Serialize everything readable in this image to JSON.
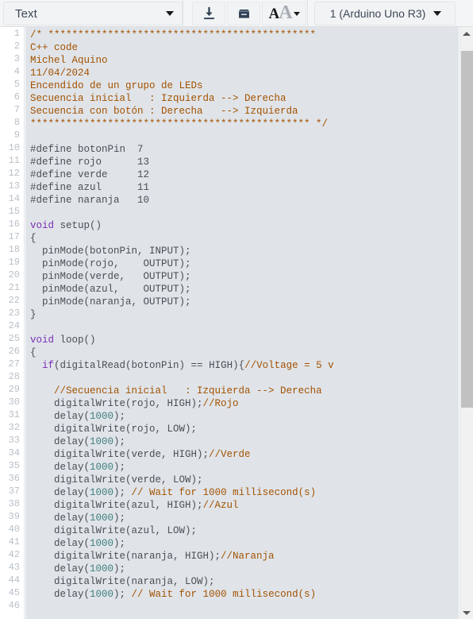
{
  "toolbar": {
    "format_select": {
      "value": "Text",
      "icon": "chevron-down-icon"
    },
    "buttons": [
      {
        "name": "download-button",
        "icon": "download-icon",
        "label": ""
      },
      {
        "name": "archive-button",
        "icon": "archive-box-icon",
        "label": ""
      },
      {
        "name": "font-size-button",
        "icon": "font-size-icon",
        "label_dark": "A",
        "label_light": "A"
      }
    ],
    "board_select": {
      "value": "1 (Arduino Uno R3)",
      "icon": "chevron-down-icon"
    }
  },
  "editor": {
    "language": "cpp",
    "first_line": 1,
    "last_visible_line": 46,
    "line_numbers": [
      "1",
      "2",
      "3",
      "4",
      "5",
      "6",
      "7",
      "8",
      "9",
      "10",
      "11",
      "12",
      "13",
      "14",
      "15",
      "16",
      "17",
      "18",
      "19",
      "20",
      "21",
      "22",
      "23",
      "24",
      "25",
      "26",
      "27",
      "28",
      "29",
      "30",
      "31",
      "32",
      "33",
      "34",
      "35",
      "36",
      "37",
      "38",
      "39",
      "40",
      "41",
      "42",
      "43",
      "44",
      "45",
      "46"
    ],
    "colors": {
      "background": "#e0e4e9",
      "gutter_background": "#ffffff",
      "gutter_text": "#b9c0c8",
      "plain_text": "#4a4f54",
      "comment": "#a35200",
      "keyword": "#7b2fb5",
      "number": "#3f7f7f",
      "scrollbar_thumb": "#c1c1c1"
    },
    "lines": [
      {
        "n": 1,
        "tokens": [
          {
            "t": "cmt",
            "s": "/* *********************************************"
          }
        ]
      },
      {
        "n": 2,
        "tokens": [
          {
            "t": "cmt",
            "s": "C++ code"
          }
        ]
      },
      {
        "n": 3,
        "tokens": [
          {
            "t": "cmt",
            "s": "Michel Aquino"
          }
        ]
      },
      {
        "n": 4,
        "tokens": [
          {
            "t": "cmt",
            "s": "11/04/2024"
          }
        ]
      },
      {
        "n": 5,
        "tokens": [
          {
            "t": "cmt",
            "s": "Encendido de un grupo de LEDs"
          }
        ]
      },
      {
        "n": 6,
        "tokens": [
          {
            "t": "cmt",
            "s": "Secuencia inicial   : Izquierda --> Derecha"
          }
        ]
      },
      {
        "n": 7,
        "tokens": [
          {
            "t": "cmt",
            "s": "Secuencia con botón : Derecha   --> Izquierda"
          }
        ]
      },
      {
        "n": 8,
        "tokens": [
          {
            "t": "cmt",
            "s": "*********************************************** */"
          }
        ]
      },
      {
        "n": 9,
        "tokens": []
      },
      {
        "n": 10,
        "tokens": [
          {
            "t": "pln",
            "s": "#define botonPin  7"
          }
        ]
      },
      {
        "n": 11,
        "tokens": [
          {
            "t": "pln",
            "s": "#define rojo      13"
          }
        ]
      },
      {
        "n": 12,
        "tokens": [
          {
            "t": "pln",
            "s": "#define verde     12"
          }
        ]
      },
      {
        "n": 13,
        "tokens": [
          {
            "t": "pln",
            "s": "#define azul      11"
          }
        ]
      },
      {
        "n": 14,
        "tokens": [
          {
            "t": "pln",
            "s": "#define naranja   10"
          }
        ]
      },
      {
        "n": 15,
        "tokens": []
      },
      {
        "n": 16,
        "tokens": [
          {
            "t": "kw",
            "s": "void"
          },
          {
            "t": "pln",
            "s": " setup()"
          }
        ]
      },
      {
        "n": 17,
        "tokens": [
          {
            "t": "pln",
            "s": "{"
          }
        ]
      },
      {
        "n": 18,
        "tokens": [
          {
            "t": "pln",
            "s": "  pinMode(botonPin, INPUT);"
          }
        ]
      },
      {
        "n": 19,
        "tokens": [
          {
            "t": "pln",
            "s": "  pinMode(rojo,    OUTPUT);"
          }
        ]
      },
      {
        "n": 20,
        "tokens": [
          {
            "t": "pln",
            "s": "  pinMode(verde,   OUTPUT);"
          }
        ]
      },
      {
        "n": 21,
        "tokens": [
          {
            "t": "pln",
            "s": "  pinMode(azul,    OUTPUT);"
          }
        ]
      },
      {
        "n": 22,
        "tokens": [
          {
            "t": "pln",
            "s": "  pinMode(naranja, OUTPUT);"
          }
        ]
      },
      {
        "n": 23,
        "tokens": [
          {
            "t": "pln",
            "s": "}"
          }
        ]
      },
      {
        "n": 24,
        "tokens": []
      },
      {
        "n": 25,
        "tokens": [
          {
            "t": "kw",
            "s": "void"
          },
          {
            "t": "pln",
            "s": " loop()"
          }
        ]
      },
      {
        "n": 26,
        "tokens": [
          {
            "t": "pln",
            "s": "{"
          }
        ]
      },
      {
        "n": 27,
        "tokens": [
          {
            "t": "pln",
            "s": "  "
          },
          {
            "t": "kw",
            "s": "if"
          },
          {
            "t": "pln",
            "s": "(digitalRead(botonPin) == HIGH){"
          },
          {
            "t": "cmt",
            "s": "//Voltage = 5 v"
          }
        ]
      },
      {
        "n": 28,
        "tokens": []
      },
      {
        "n": 29,
        "tokens": [
          {
            "t": "pln",
            "s": "    "
          },
          {
            "t": "cmt",
            "s": "//Secuencia inicial   : Izquierda --> Derecha"
          }
        ]
      },
      {
        "n": 30,
        "tokens": [
          {
            "t": "pln",
            "s": "    digitalWrite(rojo, HIGH);"
          },
          {
            "t": "cmt",
            "s": "//Rojo"
          }
        ]
      },
      {
        "n": 31,
        "tokens": [
          {
            "t": "pln",
            "s": "    delay("
          },
          {
            "t": "num",
            "s": "1000"
          },
          {
            "t": "pln",
            "s": ");"
          }
        ]
      },
      {
        "n": 32,
        "tokens": [
          {
            "t": "pln",
            "s": "    digitalWrite(rojo, LOW);"
          }
        ]
      },
      {
        "n": 33,
        "tokens": [
          {
            "t": "pln",
            "s": "    delay("
          },
          {
            "t": "num",
            "s": "1000"
          },
          {
            "t": "pln",
            "s": ");"
          }
        ]
      },
      {
        "n": 34,
        "tokens": [
          {
            "t": "pln",
            "s": "    digitalWrite(verde, HIGH);"
          },
          {
            "t": "cmt",
            "s": "//Verde"
          }
        ]
      },
      {
        "n": 35,
        "tokens": [
          {
            "t": "pln",
            "s": "    delay("
          },
          {
            "t": "num",
            "s": "1000"
          },
          {
            "t": "pln",
            "s": ");"
          }
        ]
      },
      {
        "n": 36,
        "tokens": [
          {
            "t": "pln",
            "s": "    digitalWrite(verde, LOW);"
          }
        ]
      },
      {
        "n": 37,
        "tokens": [
          {
            "t": "pln",
            "s": "    delay("
          },
          {
            "t": "num",
            "s": "1000"
          },
          {
            "t": "pln",
            "s": "); "
          },
          {
            "t": "cmt",
            "s": "// Wait for 1000 millisecond(s)"
          }
        ]
      },
      {
        "n": 38,
        "tokens": [
          {
            "t": "pln",
            "s": "    digitalWrite(azul, HIGH);"
          },
          {
            "t": "cmt",
            "s": "//Azul"
          }
        ]
      },
      {
        "n": 39,
        "tokens": [
          {
            "t": "pln",
            "s": "    delay("
          },
          {
            "t": "num",
            "s": "1000"
          },
          {
            "t": "pln",
            "s": ");"
          }
        ]
      },
      {
        "n": 40,
        "tokens": [
          {
            "t": "pln",
            "s": "    digitalWrite(azul, LOW);"
          }
        ]
      },
      {
        "n": 41,
        "tokens": [
          {
            "t": "pln",
            "s": "    delay("
          },
          {
            "t": "num",
            "s": "1000"
          },
          {
            "t": "pln",
            "s": ");"
          }
        ]
      },
      {
        "n": 42,
        "tokens": [
          {
            "t": "pln",
            "s": "    digitalWrite(naranja, HIGH);"
          },
          {
            "t": "cmt",
            "s": "//Naranja"
          }
        ]
      },
      {
        "n": 43,
        "tokens": [
          {
            "t": "pln",
            "s": "    delay("
          },
          {
            "t": "num",
            "s": "1000"
          },
          {
            "t": "pln",
            "s": ");"
          }
        ]
      },
      {
        "n": 44,
        "tokens": [
          {
            "t": "pln",
            "s": "    digitalWrite(naranja, LOW);"
          }
        ]
      },
      {
        "n": 45,
        "tokens": [
          {
            "t": "pln",
            "s": "    delay("
          },
          {
            "t": "num",
            "s": "1000"
          },
          {
            "t": "pln",
            "s": "); "
          },
          {
            "t": "cmt",
            "s": "// Wait for 1000 millisecond(s)"
          }
        ]
      },
      {
        "n": 46,
        "tokens": []
      }
    ]
  },
  "scrollbar": {
    "orientation": "vertical",
    "up_icon": "triangle-up-icon",
    "down_icon": "triangle-down-icon",
    "thumb_top_pct": 2,
    "thumb_height_pct": 63
  }
}
